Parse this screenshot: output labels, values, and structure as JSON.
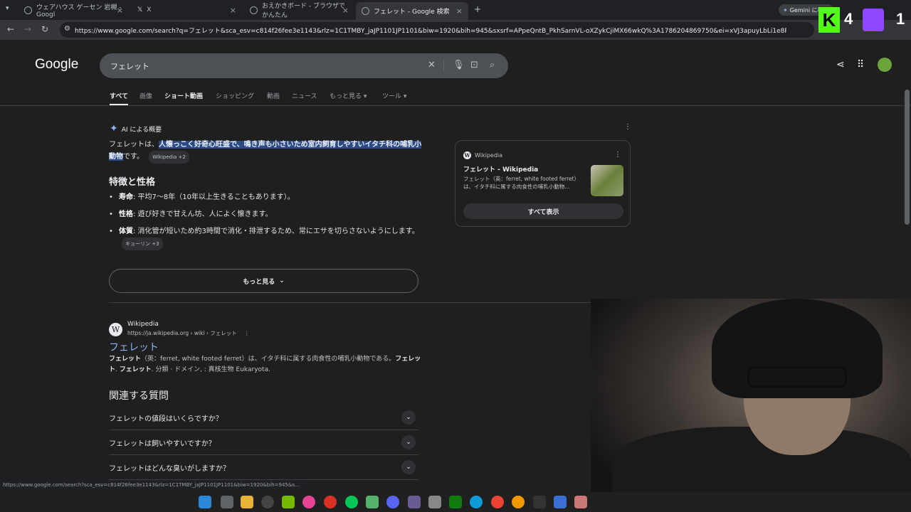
{
  "browser": {
    "tabs": [
      {
        "title": "ウェアハウス ゲーセン 岩槻 - Googl",
        "favicon": "google-icon"
      },
      {
        "title": "X",
        "favicon": "x-icon"
      },
      {
        "title": "おえかきボード - ブラウザでかんたん",
        "favicon": "globe-icon"
      },
      {
        "title": "フェレット - Google 検索",
        "favicon": "google-icon"
      }
    ],
    "new_tab": "+",
    "url": "https://www.google.com/search?q=フェレット&sca_esv=c814f26fee3e1143&rlz=1C1TMBY_jaJP1101JP1101&biw=1920&bih=945&sxsrf=APpeQntB_PkhSarnVL-oXZykCjiMX66wkQ%3A1786204869750&ei=xVJ3apuyLbLi1e8P5tmOuAI&ved=0ahUK...",
    "gemini_label": "Gemini に相談"
  },
  "google": {
    "logo": "Google",
    "query": "フェレット",
    "tabs": [
      "すべて",
      "画像",
      "ショート動画",
      "ショッピング",
      "動画",
      "ニュース",
      "もっと見る",
      "ツール"
    ]
  },
  "ai_overview": {
    "heading": "AI による概要",
    "intro_plain": "フェレットは、",
    "intro_highlight": "人懐っこく好奇心旺盛で、鳴き声も小さいため室内飼育しやすいイタチ科の哺乳小動物",
    "intro_end": "です。",
    "intro_chip": "Wikipedia +2",
    "section_title": "特徴と性格",
    "bullets": [
      {
        "term": "寿命",
        "text": ": 平均7〜8年（10年以上生きることもあります）。"
      },
      {
        "term": "性格",
        "text": ": 遊び好きで甘えん坊、人によく懐きます。"
      },
      {
        "term": "体質",
        "text": ": 消化管が短いため約3時間で消化・排泄するため、常にエサを切らさないようにします。"
      }
    ],
    "bullet3_chip": "キョーリン +3",
    "more_button": "もっと見る"
  },
  "side_card": {
    "source": "Wikipedia",
    "title": "フェレット - Wikipedia",
    "desc": "フェレット（英：ferret, white footed ferret）は、イタチ科に属する肉食性の哺乳小動物...",
    "show_all": "すべて表示"
  },
  "result": {
    "site": "Wikipedia",
    "url": "https://ja.wikipedia.org › wiki › フェレット",
    "title": "フェレット",
    "snippet_b1": "フェレット",
    "snippet_1": "（英：ferret, white footed ferret）は、イタチ科に属する肉食性の哺乳小動物である。",
    "snippet_b2": "フェレット",
    "snippet_2": ". ",
    "snippet_b3": "フェレット",
    "snippet_3": ". 分類 · ドメイン, : 真核生物 Eukaryota."
  },
  "related": {
    "heading": "関連する質問",
    "questions": [
      "フェレットの値段はいくらですか？",
      "フェレットは飼いやすいですか？",
      "フェレットはどんな臭いがしますか？"
    ]
  },
  "status_url": "https://www.google.com/search?sca_esv=c814f26fee3e1143&rlz=1C1TMBY_jaJP1101JP1101&biw=1920&bih=945&s...",
  "overlay": {
    "k_label": "K",
    "k_count": "4",
    "tw_count": "1"
  },
  "colors": {
    "accent": "#8ab4f8",
    "highlight": "#2d4a84",
    "kick": "#53fc18",
    "twitch": "#9146ff"
  }
}
